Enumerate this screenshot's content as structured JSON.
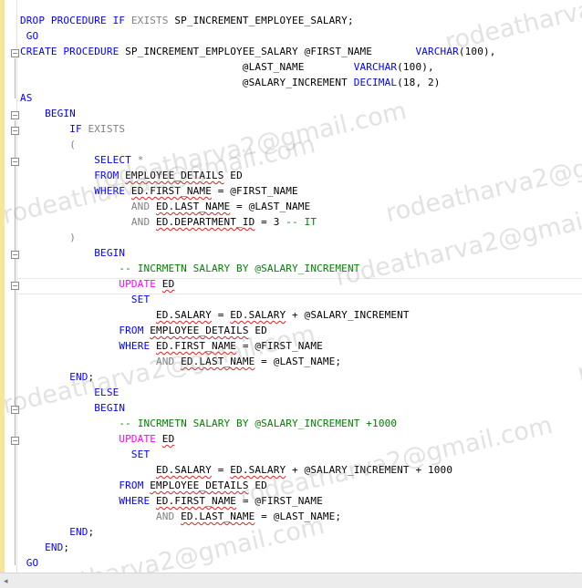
{
  "editor": {
    "lines": [
      [
        {
          "t": "DROP PROCEDURE IF ",
          "c": "kw"
        },
        {
          "t": "EXISTS",
          "c": "gray"
        },
        {
          "t": " SP_INCREMENT_EMPLOYEE_SALARY;",
          "c": ""
        }
      ],
      [
        {
          "t": " GO",
          "c": "kw"
        }
      ],
      [
        {
          "t": "CREATE PROCEDURE ",
          "c": "kw"
        },
        {
          "t": "SP_INCREMENT_EMPLOYEE_SALARY @FIRST_NAME       ",
          "c": ""
        },
        {
          "t": "VARCHAR",
          "c": "kw"
        },
        {
          "t": "(100),",
          "c": ""
        }
      ],
      [
        {
          "t": "                                    @LAST_NAME        ",
          "c": ""
        },
        {
          "t": "VARCHAR",
          "c": "kw"
        },
        {
          "t": "(100),",
          "c": ""
        }
      ],
      [
        {
          "t": "                                    @SALARY_INCREMENT ",
          "c": ""
        },
        {
          "t": "DECIMAL",
          "c": "kw"
        },
        {
          "t": "(18, 2)",
          "c": ""
        }
      ],
      [
        {
          "t": "AS",
          "c": "kw"
        }
      ],
      [
        {
          "t": "    ",
          "c": ""
        },
        {
          "t": "BEGIN",
          "c": "kw"
        }
      ],
      [
        {
          "t": "        ",
          "c": ""
        },
        {
          "t": "IF ",
          "c": "kw"
        },
        {
          "t": "EXISTS",
          "c": "gray"
        }
      ],
      [
        {
          "t": "        ",
          "c": ""
        },
        {
          "t": "(",
          "c": "gray"
        }
      ],
      [
        {
          "t": "            ",
          "c": ""
        },
        {
          "t": "SELECT",
          "c": "kw"
        },
        {
          "t": " *",
          "c": "gray"
        }
      ],
      [
        {
          "t": "            ",
          "c": ""
        },
        {
          "t": "FROM ",
          "c": "kw"
        },
        {
          "t": "EMPLOYEE_DETAILS",
          "c": "sq"
        },
        {
          "t": " ED",
          "c": ""
        }
      ],
      [
        {
          "t": "            ",
          "c": ""
        },
        {
          "t": "WHERE ",
          "c": "kw"
        },
        {
          "t": "ED.FIRST_NAME",
          "c": "sq"
        },
        {
          "t": " = @FIRST_NAME",
          "c": ""
        }
      ],
      [
        {
          "t": "                  ",
          "c": ""
        },
        {
          "t": "AND ",
          "c": "gray"
        },
        {
          "t": "ED.LAST_NAME",
          "c": "sq"
        },
        {
          "t": " = @LAST_NAME",
          "c": ""
        }
      ],
      [
        {
          "t": "                  ",
          "c": ""
        },
        {
          "t": "AND ",
          "c": "gray"
        },
        {
          "t": "ED.DEPARTMENT_ID",
          "c": "sq"
        },
        {
          "t": " = 3 ",
          "c": ""
        },
        {
          "t": "-- IT",
          "c": "cm"
        }
      ],
      [
        {
          "t": "        ",
          "c": ""
        },
        {
          "t": ")",
          "c": "gray"
        }
      ],
      [
        {
          "t": "            ",
          "c": ""
        },
        {
          "t": "BEGIN",
          "c": "kw"
        }
      ],
      [
        {
          "t": "                ",
          "c": ""
        },
        {
          "t": "-- INCRMETN SALARY BY @SALARY_INCREMENT",
          "c": "cm"
        }
      ],
      [
        {
          "t": "                ",
          "c": ""
        },
        {
          "t": "UPDATE",
          "c": "fn"
        },
        {
          "t": " ",
          "c": ""
        },
        {
          "t": "ED",
          "c": "sq"
        }
      ],
      [
        {
          "t": "                  ",
          "c": ""
        },
        {
          "t": "SET",
          "c": "kw"
        }
      ],
      [
        {
          "t": "                      ",
          "c": ""
        },
        {
          "t": "ED.SALARY",
          "c": "sq"
        },
        {
          "t": " = ",
          "c": ""
        },
        {
          "t": "ED.SALARY",
          "c": "sq"
        },
        {
          "t": " + @SALARY_INCREMENT",
          "c": ""
        }
      ],
      [
        {
          "t": "                ",
          "c": ""
        },
        {
          "t": "FROM ",
          "c": "kw"
        },
        {
          "t": "EMPLOYEE_DETAILS",
          "c": "sq"
        },
        {
          "t": " ED",
          "c": ""
        }
      ],
      [
        {
          "t": "                ",
          "c": ""
        },
        {
          "t": "WHERE ",
          "c": "kw"
        },
        {
          "t": "ED.FIRST_NAME",
          "c": "sq"
        },
        {
          "t": " = @FIRST_NAME",
          "c": ""
        }
      ],
      [
        {
          "t": "                      ",
          "c": ""
        },
        {
          "t": "AND ",
          "c": "gray"
        },
        {
          "t": "ED.LAST_NAME",
          "c": "sq"
        },
        {
          "t": " = @LAST_NAME;",
          "c": ""
        }
      ],
      [
        {
          "t": "        ",
          "c": ""
        },
        {
          "t": "END",
          "c": "kw"
        },
        {
          "t": ";",
          "c": ""
        }
      ],
      [
        {
          "t": "            ",
          "c": ""
        },
        {
          "t": "ELSE",
          "c": "kw"
        }
      ],
      [
        {
          "t": "            ",
          "c": ""
        },
        {
          "t": "BEGIN",
          "c": "kw"
        }
      ],
      [
        {
          "t": "                ",
          "c": ""
        },
        {
          "t": "-- INCRMETN SALARY BY @SALARY_INCREMENT +1000",
          "c": "cm"
        }
      ],
      [
        {
          "t": "                ",
          "c": ""
        },
        {
          "t": "UPDATE",
          "c": "fn"
        },
        {
          "t": " ",
          "c": ""
        },
        {
          "t": "ED",
          "c": "sq"
        }
      ],
      [
        {
          "t": "                  ",
          "c": ""
        },
        {
          "t": "SET",
          "c": "kw"
        }
      ],
      [
        {
          "t": "                      ",
          "c": ""
        },
        {
          "t": "ED.SALARY",
          "c": "sq"
        },
        {
          "t": " = ",
          "c": ""
        },
        {
          "t": "ED.SALARY",
          "c": "sq"
        },
        {
          "t": " + @SALARY_INCREMENT + 1000",
          "c": ""
        }
      ],
      [
        {
          "t": "                ",
          "c": ""
        },
        {
          "t": "FROM ",
          "c": "kw"
        },
        {
          "t": "EMPLOYEE_DETAILS",
          "c": "sq"
        },
        {
          "t": " ED",
          "c": ""
        }
      ],
      [
        {
          "t": "                ",
          "c": ""
        },
        {
          "t": "WHERE ",
          "c": "kw"
        },
        {
          "t": "ED.FIRST_NAME",
          "c": "sq"
        },
        {
          "t": " = @FIRST_NAME",
          "c": ""
        }
      ],
      [
        {
          "t": "                      ",
          "c": ""
        },
        {
          "t": "AND ",
          "c": "gray"
        },
        {
          "t": "ED.LAST_NAME",
          "c": "sq"
        },
        {
          "t": " = @LAST_NAME;",
          "c": ""
        }
      ],
      [
        {
          "t": "        ",
          "c": ""
        },
        {
          "t": "END",
          "c": "kw"
        },
        {
          "t": ";",
          "c": ""
        }
      ],
      [
        {
          "t": "    ",
          "c": ""
        },
        {
          "t": "END",
          "c": "kw"
        },
        {
          "t": ";",
          "c": ""
        }
      ],
      [
        {
          "t": " GO",
          "c": "kw"
        }
      ]
    ]
  },
  "watermarks": [
    "rodeatharva2@gmail.com",
    "rodeatharva2@gmail.com",
    "rodeatharva2@gmail.com",
    "rodeatharva2@gmail.com",
    "rodeatharva2@gmail.com",
    "rodeatharva2@gmail.com",
    "rodeatharva2@gmail.com",
    "rodeatharva2@gmail.com",
    "rodeatharva2@gmail.com",
    "rodeatharva2@gmail.com"
  ],
  "colors": {
    "keyword": "#0000ff",
    "operator": "#808080",
    "function": "#ff00ff",
    "comment": "#008000",
    "error_squiggle": "#e01f1f",
    "change_bar": "#f7e69a"
  }
}
